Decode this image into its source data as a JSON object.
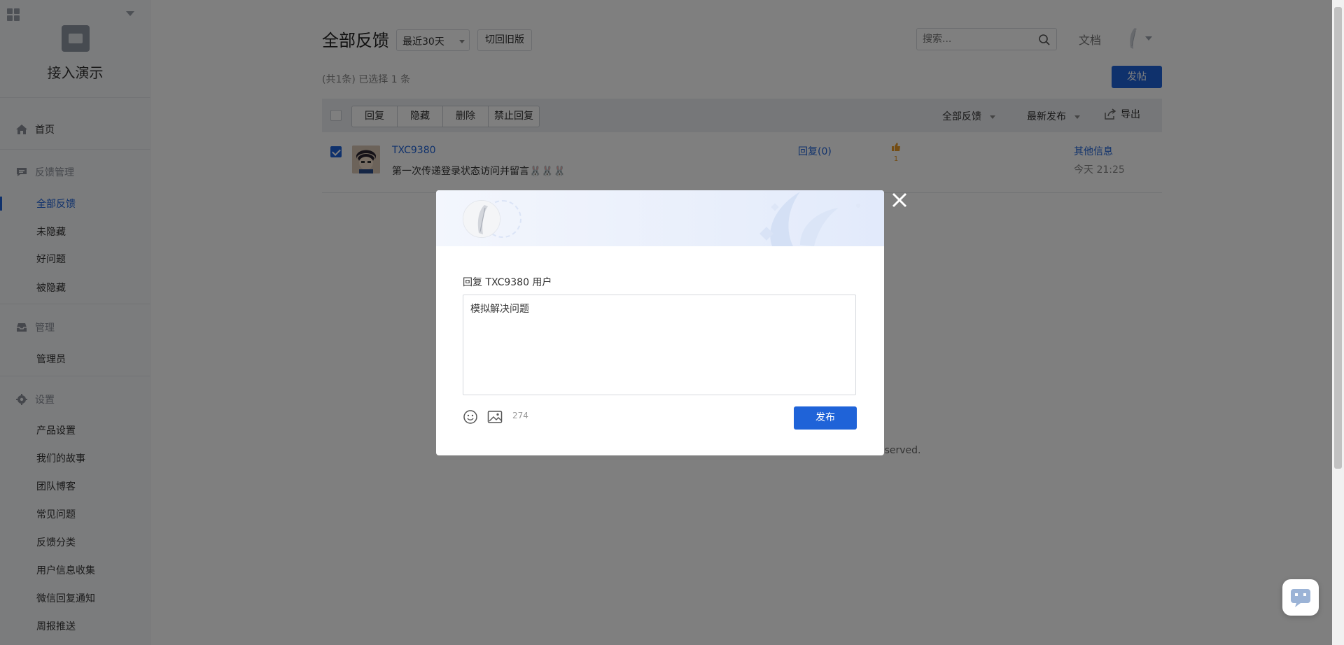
{
  "sidebar": {
    "app_name": "接入演示",
    "nav": {
      "home": "首页",
      "feedback_group": "反馈管理",
      "all_feedback": "全部反馈",
      "not_hidden": "未隐藏",
      "good_questions": "好问题",
      "hidden": "被隐藏",
      "manage_group": "管理",
      "admins": "管理员",
      "settings_group": "设置",
      "product_settings": "产品设置",
      "our_story": "我们的故事",
      "team_blog": "团队博客",
      "faq": "常见问题",
      "feedback_categories": "反馈分类",
      "user_info_collection": "用户信息收集",
      "wechat_reply_notify": "微信回复通知",
      "weekly_report": "周报推送"
    }
  },
  "header": {
    "title": "全部反馈",
    "date_range": "最近30天",
    "old_version_button": "切回旧版",
    "search_placeholder": "搜索...",
    "docs_link": "文档",
    "post_button": "发帖"
  },
  "summary": "(共1条) 已选择 1 条",
  "toolbar": {
    "reply": "回复",
    "hide": "隐藏",
    "delete": "删除",
    "disable_reply": "禁止回复",
    "filter_all": "全部反馈",
    "sort_latest": "最新发布",
    "export": "导出"
  },
  "posts": [
    {
      "username": "TXC9380",
      "content": "第一次传递登录状态访问并留言🐰🐰🐰",
      "replies": "回复(0)",
      "likes": "1",
      "other_info": "其他信息",
      "time": "今天 21:25"
    }
  ],
  "footer": {
    "left": "",
    "right": "eserved."
  },
  "modal": {
    "reply_to": "回复 TXC9380 用户",
    "reply_text": "模拟解决问题",
    "char_count": "274",
    "publish_button": "发布"
  },
  "colors": {
    "primary": "#1f63d8",
    "like": "#e89a28"
  }
}
